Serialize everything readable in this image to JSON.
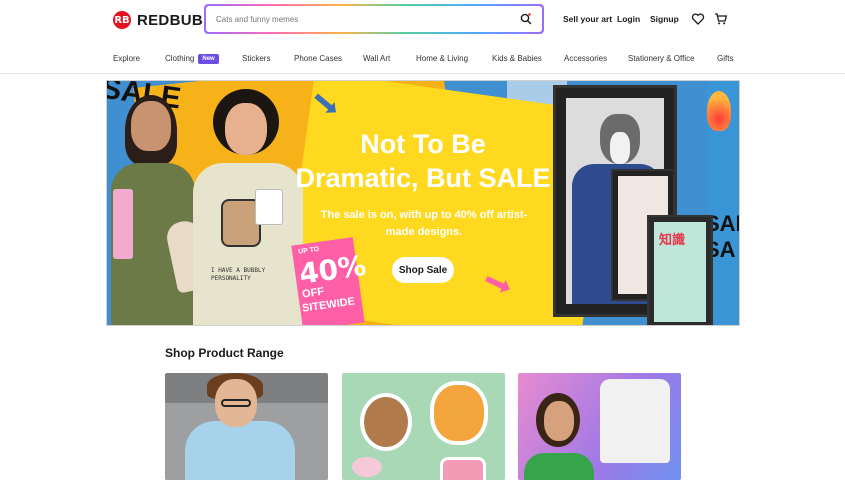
{
  "brand": {
    "name": "REDBUBBLE",
    "mark": "RB"
  },
  "search": {
    "placeholder": "Cats and funny memes",
    "value": ""
  },
  "header_links": {
    "sell": "Sell your art",
    "login": "Login",
    "signup": "Signup"
  },
  "nav": {
    "items": [
      "Explore",
      "Clothing",
      "Stickers",
      "Phone Cases",
      "Wall Art",
      "Home & Living",
      "Kids & Babies",
      "Accessories",
      "Stationery & Office",
      "Gifts"
    ],
    "new_badge": "New"
  },
  "hero": {
    "title_line1": "Not To Be",
    "title_line2": "Dramatic, But SALE",
    "subtitle": "The sale is on, with up to 40% off artist-made designs.",
    "cta": "Shop Sale",
    "tag_upto": "UP TO",
    "tag_percent": "40%",
    "tag_off": "OFF",
    "tag_sitewide": "SITEWIDE",
    "shirt_text": "I HAVE A BUBBLY PERSONALITY",
    "deco_sale_left": "SALE",
    "deco_sale_right": "SAL SA",
    "frame_text": "知識"
  },
  "section": {
    "title": "Shop Product Range"
  },
  "colors": {
    "brand_red": "#e41321",
    "accent_purple": "#6c4ee3",
    "hero_blue": "#3f8fd1",
    "hero_yellow": "#ffd91f"
  }
}
